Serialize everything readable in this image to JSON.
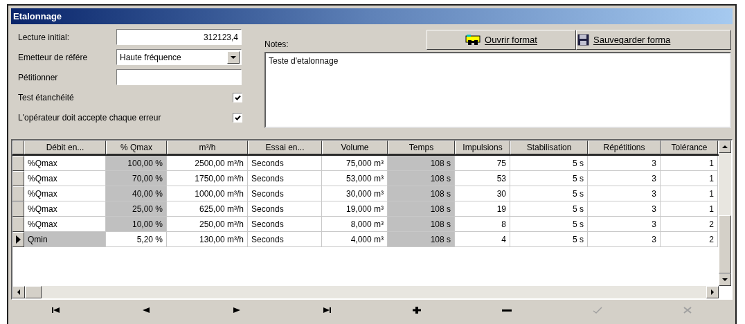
{
  "window": {
    "title": "Etalonnage"
  },
  "form": {
    "fields": [
      {
        "kind": "text",
        "label": "Lecture initial:",
        "value": "312123,4"
      },
      {
        "kind": "dropdown",
        "label": "Emetteur de référe",
        "value": "Haute fréquence"
      },
      {
        "kind": "text",
        "label": "Pétitionner"
      },
      {
        "kind": "checkbox",
        "label": "Test étanchéité",
        "checked": true
      },
      {
        "kind": "checkbox",
        "label": "L'opérateur doit accepte chaque erreur",
        "checked": true
      }
    ],
    "notes": {
      "label": "Notes:",
      "value": "Teste d'etalonnage"
    },
    "buttons": [
      {
        "kind": "open",
        "label": "Ouvrir format"
      },
      {
        "kind": "save",
        "label": "Sauvegarder forma"
      }
    ]
  },
  "table": {
    "columns": [
      {
        "label": "Débit en...",
        "kind": "text"
      },
      {
        "label": "% Qmax",
        "kind": "number"
      },
      {
        "label": "m³/h",
        "kind": "number"
      },
      {
        "label": "Essai en...",
        "kind": "text"
      },
      {
        "label": "Volume",
        "kind": "number"
      },
      {
        "label": "Temps",
        "kind": "number"
      },
      {
        "label": "Impulsions",
        "kind": "number"
      },
      {
        "label": "Stabilisation",
        "kind": "number"
      },
      {
        "label": "Répétitions",
        "kind": "number"
      },
      {
        "label": "Tolérance",
        "kind": "number"
      }
    ],
    "rows": [
      {
        "current": false,
        "cells": [
          {
            "text": "%Qmax",
            "shaded": false
          },
          {
            "text": "100,00 %",
            "shaded": true
          },
          {
            "text": "2500,00 m³/h",
            "shaded": false
          },
          {
            "text": "Seconds",
            "shaded": false
          },
          {
            "text": "75,000 m³",
            "shaded": false
          },
          {
            "text": "108 s",
            "shaded": true
          },
          {
            "text": "75",
            "shaded": false
          },
          {
            "text": "5 s",
            "shaded": false
          },
          {
            "text": "3",
            "shaded": false
          },
          {
            "text": "1",
            "shaded": false
          }
        ]
      },
      {
        "current": false,
        "cells": [
          {
            "text": "%Qmax",
            "shaded": false
          },
          {
            "text": "70,00 %",
            "shaded": true
          },
          {
            "text": "1750,00 m³/h",
            "shaded": false
          },
          {
            "text": "Seconds",
            "shaded": false
          },
          {
            "text": "53,000 m³",
            "shaded": false
          },
          {
            "text": "108 s",
            "shaded": true
          },
          {
            "text": "53",
            "shaded": false
          },
          {
            "text": "5 s",
            "shaded": false
          },
          {
            "text": "3",
            "shaded": false
          },
          {
            "text": "1",
            "shaded": false
          }
        ]
      },
      {
        "current": false,
        "cells": [
          {
            "text": "%Qmax",
            "shaded": false
          },
          {
            "text": "40,00 %",
            "shaded": true
          },
          {
            "text": "1000,00 m³/h",
            "shaded": false
          },
          {
            "text": "Seconds",
            "shaded": false
          },
          {
            "text": "30,000 m³",
            "shaded": false
          },
          {
            "text": "108 s",
            "shaded": true
          },
          {
            "text": "30",
            "shaded": false
          },
          {
            "text": "5 s",
            "shaded": false
          },
          {
            "text": "3",
            "shaded": false
          },
          {
            "text": "1",
            "shaded": false
          }
        ]
      },
      {
        "current": false,
        "cells": [
          {
            "text": "%Qmax",
            "shaded": false
          },
          {
            "text": "25,00 %",
            "shaded": true
          },
          {
            "text": "625,00 m³/h",
            "shaded": false
          },
          {
            "text": "Seconds",
            "shaded": false
          },
          {
            "text": "19,000 m³",
            "shaded": false
          },
          {
            "text": "108 s",
            "shaded": true
          },
          {
            "text": "19",
            "shaded": false
          },
          {
            "text": "5 s",
            "shaded": false
          },
          {
            "text": "3",
            "shaded": false
          },
          {
            "text": "1",
            "shaded": false
          }
        ]
      },
      {
        "current": false,
        "cells": [
          {
            "text": "%Qmax",
            "shaded": false
          },
          {
            "text": "10,00 %",
            "shaded": true
          },
          {
            "text": "250,00 m³/h",
            "shaded": false
          },
          {
            "text": "Seconds",
            "shaded": false
          },
          {
            "text": "8,000 m³",
            "shaded": false
          },
          {
            "text": "108 s",
            "shaded": true
          },
          {
            "text": "8",
            "shaded": false
          },
          {
            "text": "5 s",
            "shaded": false
          },
          {
            "text": "3",
            "shaded": false
          },
          {
            "text": "2",
            "shaded": false
          }
        ]
      },
      {
        "current": true,
        "cells": [
          {
            "text": "Qmin",
            "shaded": true
          },
          {
            "text": "5,20 %",
            "shaded": false
          },
          {
            "text": "130,00 m³/h",
            "shaded": false
          },
          {
            "text": "Seconds",
            "shaded": false
          },
          {
            "text": "4,000 m³",
            "shaded": false
          },
          {
            "text": "108 s",
            "shaded": true
          },
          {
            "text": "4",
            "shaded": false
          },
          {
            "text": "5 s",
            "shaded": false
          },
          {
            "text": "3",
            "shaded": false
          },
          {
            "text": "2",
            "shaded": false
          }
        ]
      }
    ]
  },
  "navigator": [
    {
      "kind": "first",
      "disabled": false
    },
    {
      "kind": "prior",
      "disabled": false
    },
    {
      "kind": "next",
      "disabled": false
    },
    {
      "kind": "last",
      "disabled": false
    },
    {
      "kind": "insert",
      "disabled": false
    },
    {
      "kind": "delete",
      "disabled": false
    },
    {
      "kind": "post",
      "disabled": true
    },
    {
      "kind": "cancel",
      "disabled": true
    }
  ]
}
